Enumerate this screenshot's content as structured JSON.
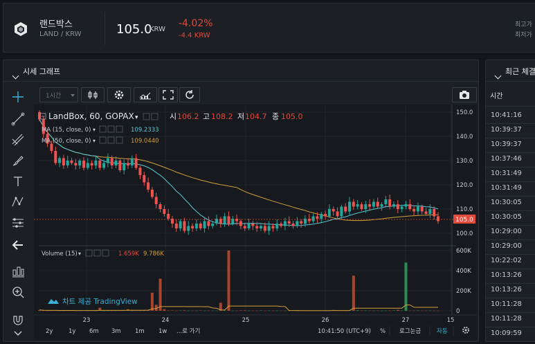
{
  "ticker": {
    "name": "랜드박스",
    "pair": "LAND / KRW",
    "price": "105.0",
    "price_unit": "KRW",
    "change_pct": "-4.02%",
    "change_abs": "-4.4 KRW",
    "high_label": "최고가",
    "low_label": "최저가"
  },
  "chart_panel": {
    "title": "시세 그래프",
    "interval_button": "1시간",
    "legend_main": "LandBox, 60, GOPAX",
    "ohlc": {
      "o_label": "시",
      "o": "106.2",
      "h_label": "고",
      "h": "108.2",
      "l_label": "저",
      "l": "104.7",
      "c_label": "종",
      "c": "105.0"
    },
    "ma15_label": "MA (15, close, 0)",
    "ma15_value": "109.2333",
    "ma50_label": "MA (50, close, 0)",
    "ma50_value": "109.0440",
    "volume_label": "Volume (15)",
    "volume_value": "1.659K",
    "volume_ma_value": "9.786K",
    "watermark": "차트 제공 TradingView",
    "price_tag": "105.0",
    "periods": [
      "2y",
      "1y",
      "6m",
      "3m",
      "1m",
      "1w",
      "...로 가기"
    ],
    "time_display": "10:41:50 (UTC+9)",
    "pct_label": "%",
    "log_label": "로그눈금",
    "auto_label": "자동",
    "colors": {
      "up": "#26a69a",
      "down": "#ef5350",
      "ma15": "#5ac8d8",
      "ma50": "#d4a03a",
      "volume_down": "#a8452f",
      "volume_up": "#2d8a55"
    }
  },
  "trades_panel": {
    "title": "최근 체결",
    "header_time": "시간",
    "times": [
      "10:41:16",
      "10:39:37",
      "10:39:37",
      "10:37:46",
      "10:31:49",
      "10:31:49",
      "10:30:05",
      "10:30:05",
      "10:29:00",
      "10:29:00",
      "10:22:02",
      "10:13:26",
      "10:13:26",
      "10:11:28",
      "10:11:28",
      "10:09:59"
    ]
  },
  "chart_data": {
    "type": "candlestick",
    "x_ticks": [
      "23",
      "24",
      "25",
      "26",
      "27",
      "15"
    ],
    "y_ticks": [
      "150.0",
      "140.0",
      "130.0",
      "120.0",
      "110.0",
      "100.0"
    ],
    "volume_ticks": [
      "600K",
      "400K",
      "200K",
      "0"
    ],
    "price_range": [
      96,
      152
    ],
    "volume_range": [
      0,
      620000
    ],
    "closes": [
      147,
      141,
      137,
      134,
      129,
      131,
      128,
      130,
      129,
      128,
      130,
      127,
      129,
      128,
      130,
      127,
      129,
      131,
      128,
      130,
      126,
      129,
      128,
      131,
      127,
      124,
      121,
      118,
      115,
      112,
      110,
      108,
      106,
      104,
      102,
      105,
      101,
      103,
      102,
      104,
      102,
      105,
      103,
      104,
      106,
      104,
      107,
      104,
      106,
      105,
      103,
      102,
      104,
      103,
      102,
      103,
      101,
      103,
      102,
      104,
      103,
      105,
      104,
      103,
      105,
      104,
      106,
      105,
      107,
      106,
      108,
      107,
      110,
      109,
      107,
      111,
      109,
      113,
      111,
      112,
      110,
      112,
      111,
      113,
      111,
      112,
      114,
      111,
      112,
      110,
      111,
      112,
      110,
      109,
      111,
      109,
      108,
      110,
      107,
      105
    ],
    "volumes": [
      8000,
      3000,
      2000,
      2500,
      5000,
      2000,
      1500,
      3000,
      2000,
      1500,
      2000,
      3500,
      2500,
      2000,
      1800,
      30000,
      1500,
      2000,
      1800,
      2500,
      3000,
      4500,
      15000,
      2000,
      4000,
      2500,
      8000,
      9000,
      180000,
      60000,
      320000,
      15000,
      3500,
      3500,
      2000,
      3000,
      5000,
      2500,
      1800,
      2000,
      3500,
      2000,
      2500,
      1500,
      2000,
      80000,
      3000,
      600000,
      2000,
      1500,
      4000,
      5000,
      2500,
      2000,
      1800,
      3500,
      2000,
      2500,
      1500,
      2000,
      2500,
      1800,
      2000,
      2800,
      1500,
      1800,
      2500,
      1500,
      2000,
      1800,
      3000,
      2500,
      1500,
      8000,
      2000,
      2200,
      1500,
      3000,
      350000,
      5000,
      2500,
      3000,
      2000,
      1800,
      2500,
      1500,
      2000,
      2200,
      3500,
      9000,
      3000,
      480000,
      2500,
      2000,
      2800,
      1500,
      2000,
      2500,
      1659,
      1659
    ]
  }
}
